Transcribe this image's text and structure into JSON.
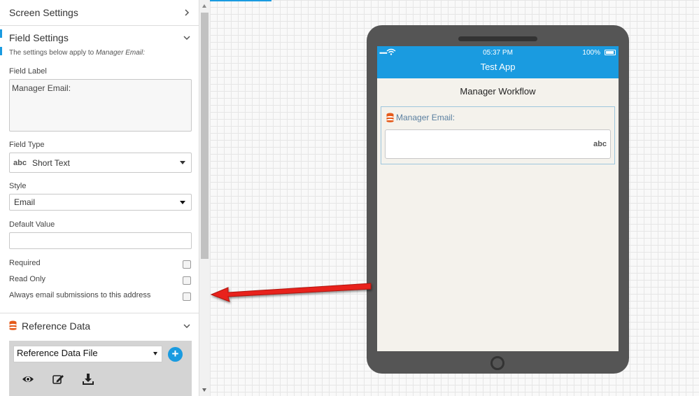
{
  "panel": {
    "screen_settings": "Screen Settings",
    "field_settings": "Field Settings",
    "help_prefix": "The settings below apply to ",
    "help_field": "Manager Email:",
    "field_label_title": "Field Label",
    "field_label_value": "Manager Email:",
    "field_type_title": "Field Type",
    "field_type_icon": "abc",
    "field_type_value": "Short Text",
    "style_title": "Style",
    "style_value": "Email",
    "default_value_title": "Default Value",
    "default_value": "",
    "required_label": "Required",
    "read_only_label": "Read Only",
    "email_label": "Always email submissions to this address",
    "reference_data": "Reference Data",
    "reference_file": "Reference Data File",
    "plus": "+"
  },
  "device": {
    "time": "05:37 PM",
    "battery": "100%",
    "app_title": "Test App",
    "workflow_title": "Manager Workflow",
    "field_label": "Manager Email:",
    "field_type_hint": "abc"
  },
  "colors": {
    "accent": "#1a9be0",
    "device_frame": "#555555",
    "screen_bg": "#f4f2ec",
    "arrow": "#e8201a",
    "db_icon": "#e55a1a"
  },
  "icons": [
    "chevron-right-icon",
    "chevron-down-icon",
    "database-icon",
    "eye-icon",
    "edit-icon",
    "download-icon",
    "wifi-icon",
    "battery-icon"
  ]
}
